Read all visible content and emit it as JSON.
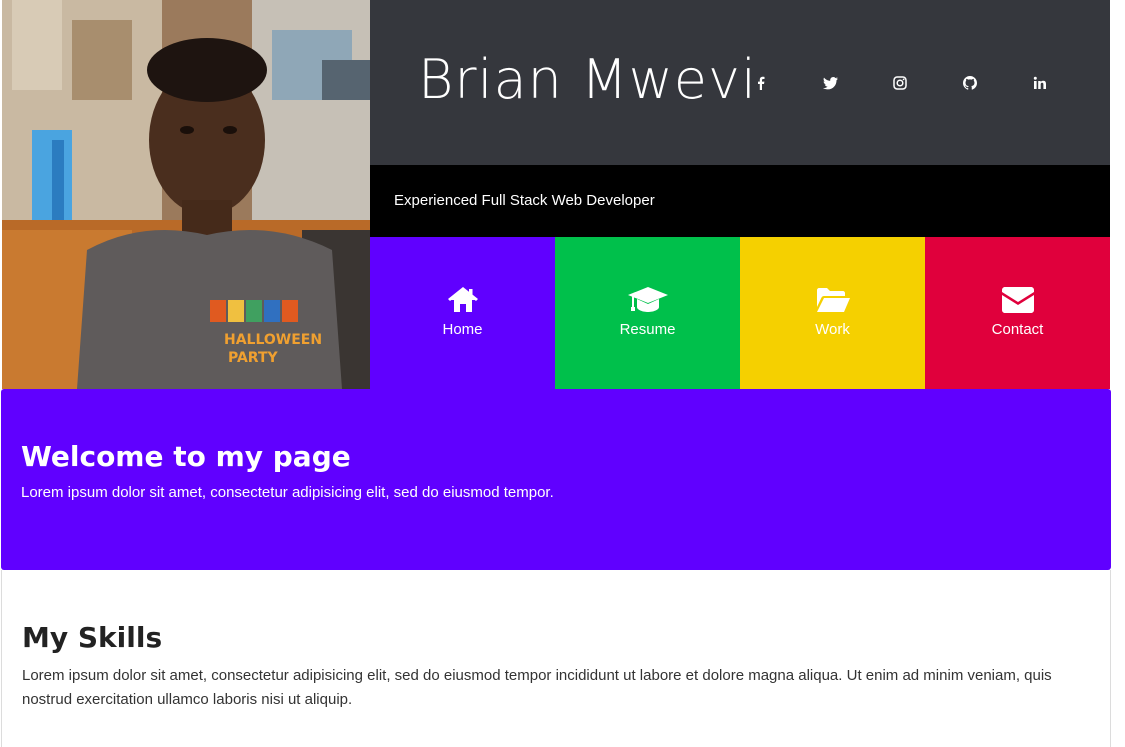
{
  "profile": {
    "name": "Brian Mwevi",
    "tagline": "Experienced Full Stack Web Developer",
    "photo_text_line1": "HALLOWEEN",
    "photo_text_line2": "PARTY"
  },
  "social": [
    {
      "name": "facebook-icon"
    },
    {
      "name": "twitter-icon"
    },
    {
      "name": "instagram-icon"
    },
    {
      "name": "github-icon"
    },
    {
      "name": "linkedin-icon"
    }
  ],
  "nav": {
    "items": [
      {
        "label": "Home",
        "icon": "home-icon",
        "color": "#6000ff"
      },
      {
        "label": "Resume",
        "icon": "graduation-cap-icon",
        "color": "#00c04b"
      },
      {
        "label": "Work",
        "icon": "folder-open-icon",
        "color": "#f5d000"
      },
      {
        "label": "Contact",
        "icon": "envelope-icon",
        "color": "#e0003c"
      }
    ]
  },
  "welcome": {
    "title": "Welcome to my page",
    "text": "Lorem ipsum dolor sit amet, consectetur adipisicing elit, sed do eiusmod tempor."
  },
  "skills": {
    "title": "My Skills",
    "text": "Lorem ipsum dolor sit amet, consectetur adipisicing elit, sed do eiusmod tempor incididunt ut labore et dolore magna aliqua. Ut enim ad minim veniam, quis nostrud exercitation ullamco laboris nisi ut aliquip."
  },
  "colors": {
    "header_dark": "#35373d",
    "tagline_bg": "#000000",
    "welcome_bg": "#6000ff"
  }
}
